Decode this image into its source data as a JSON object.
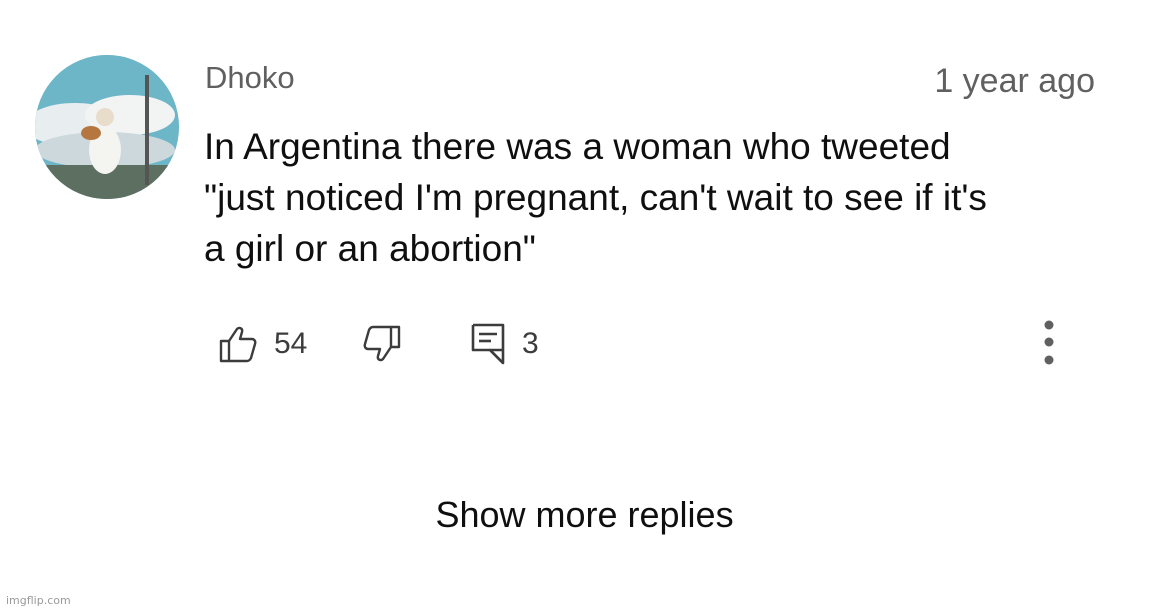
{
  "comment": {
    "author": "Dhoko",
    "timestamp": "1 year ago",
    "text": "In Argentina there was a woman who tweeted\n\"just noticed I'm pregnant, can't wait to see if it's\na girl or an abortion\""
  },
  "actions": {
    "like_icon": "thumbs-up-icon",
    "like_count": "54",
    "dislike_icon": "thumbs-down-icon",
    "reply_icon": "comment-icon",
    "reply_count": "3",
    "more_icon": "vertical-ellipsis-icon"
  },
  "replies": {
    "show_more_label": "Show more replies"
  },
  "watermark": "imgflip.com"
}
